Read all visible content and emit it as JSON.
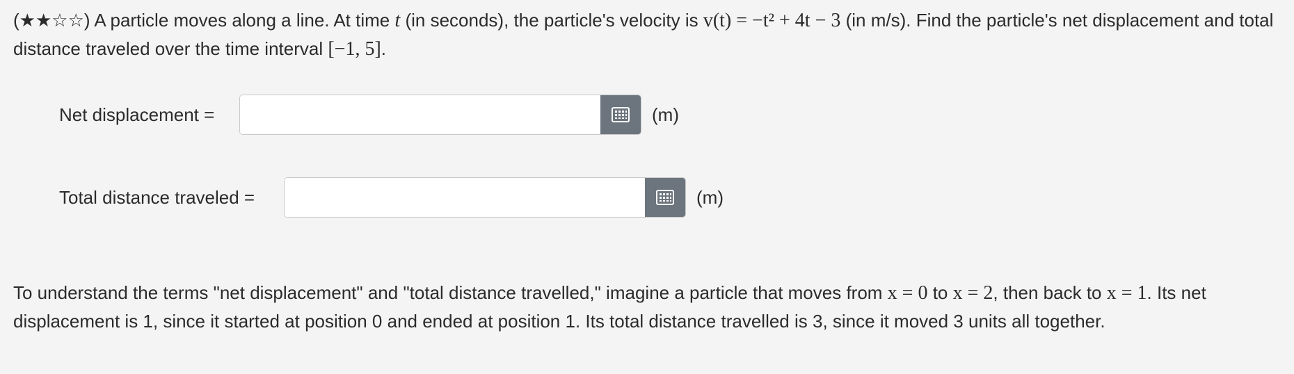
{
  "problem": {
    "rating": "(★★☆☆)",
    "text_1": " A particle moves along a line. At time ",
    "var_t": "t",
    "text_2": " (in seconds), the particle's velocity is ",
    "velocity_formula": "v(t) = −t² + 4t − 3",
    "text_3": " (in m/s). Find the particle's net displacement and total distance traveled over the time interval ",
    "interval": "[−1, 5]",
    "text_4": "."
  },
  "net_displacement": {
    "label": "Net displacement =",
    "value": "",
    "placeholder": "",
    "unit": "(m)"
  },
  "total_distance": {
    "label": "Total distance traveled =",
    "value": "",
    "placeholder": "",
    "unit": "(m)"
  },
  "hint": {
    "text_1": "To understand the terms \"net displacement\" and \"total distance travelled,\" imagine a particle that moves from ",
    "expr_1": "x = 0",
    "text_2": " to ",
    "expr_2": "x = 2",
    "text_3": ", then back to ",
    "expr_3": "x = 1",
    "text_4": ". Its net displacement is 1, since it started at position 0 and ended at position 1. Its total distance travelled is 3, since it moved 3 units all together."
  },
  "icons": {
    "answer_button_icon": "keypad-grid-icon"
  },
  "colors": {
    "background": "#f4f4f4",
    "button": "#6c757d",
    "text": "#2b2b2b"
  }
}
